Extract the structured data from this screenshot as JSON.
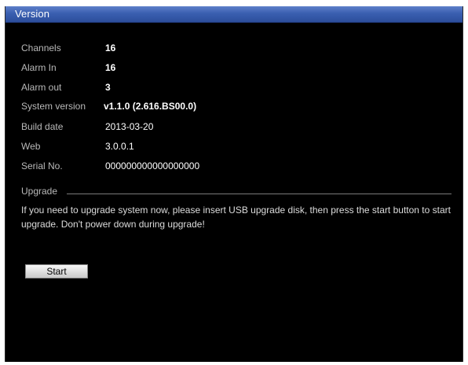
{
  "window": {
    "title": "Version"
  },
  "info": {
    "channels_label": "Channels",
    "channels_value": "16",
    "alarm_in_label": "Alarm In",
    "alarm_in_value": "16",
    "alarm_out_label": "Alarm out",
    "alarm_out_value": "3",
    "system_version_label": "System version",
    "system_version_value": "v1.1.0 (2.616.BS00.0)",
    "build_date_label": "Build date",
    "build_date_value": "2013-03-20",
    "web_label": "Web",
    "web_value": "3.0.0.1",
    "serial_label": "Serial No.",
    "serial_value": "000000000000000000"
  },
  "upgrade": {
    "section_label": "Upgrade",
    "message": "If you need to upgrade system now, please insert USB upgrade disk, then press the start button to start upgrade. Don't power down during upgrade!",
    "start_label": "Start"
  },
  "colors": {
    "titlebar": "#3a5fb0",
    "background": "#000000",
    "label_text": "#b9b9b9",
    "value_text": "#ffffff"
  }
}
